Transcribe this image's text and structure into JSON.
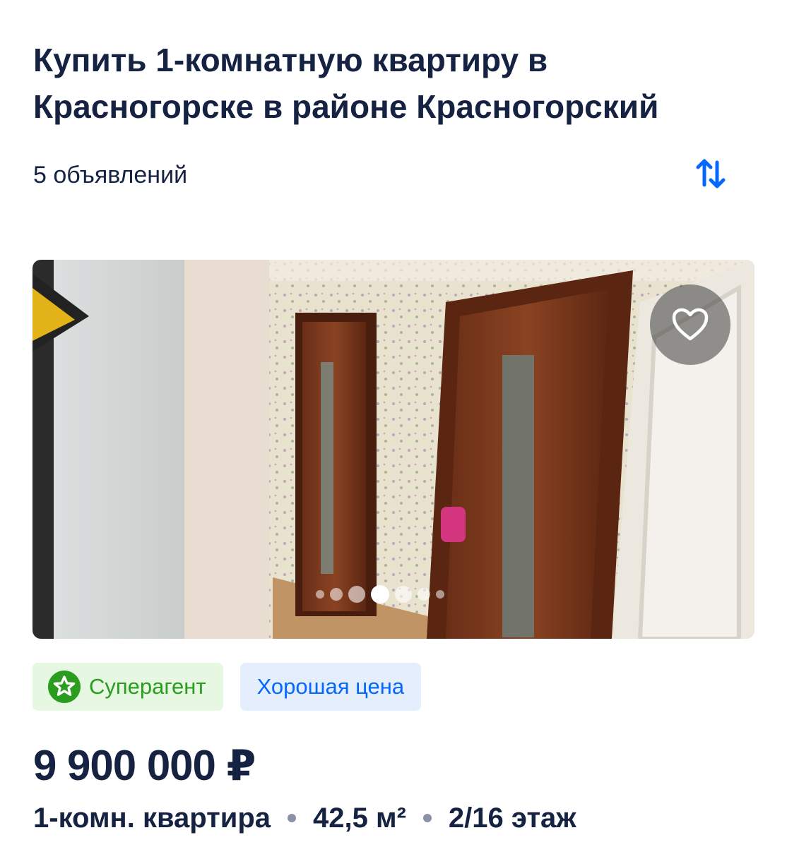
{
  "header": {
    "title": "Купить 1-комнатную квартиру в Красногорске в районе Красногорский",
    "count": "5 объявлений"
  },
  "icons": {
    "sort": "sort-arrows-icon",
    "favorite": "heart-icon",
    "superagent": "star-badge-icon"
  },
  "colors": {
    "primary_text": "#152242",
    "accent_blue": "#0468ff",
    "super_green": "#2a9d1f"
  },
  "listing": {
    "gallery": {
      "dot_count": 7,
      "active_index": 3
    },
    "badges": {
      "superagent": "Суперагент",
      "good_price": "Хорошая цена"
    },
    "price": "9 900 000 ₽",
    "rooms": "1-комн. квартира",
    "area": "42,5 м²",
    "floor": "2/16 этаж"
  }
}
